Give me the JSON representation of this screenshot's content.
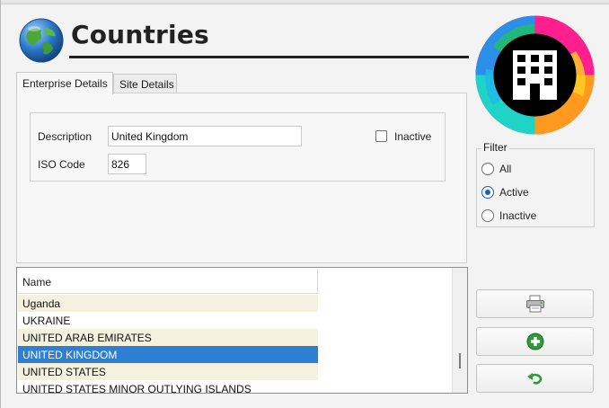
{
  "header": {
    "title": "Countries",
    "globe_icon": "globe-icon",
    "logo_icon": "building-icon"
  },
  "tabs": [
    {
      "label": "Enterprise Details",
      "active": true
    },
    {
      "label": "Site Details",
      "active": false
    }
  ],
  "details": {
    "description_label": "Description",
    "description_value": "United Kingdom",
    "iso_label": "ISO Code",
    "iso_value": "826",
    "inactive_label": "Inactive",
    "inactive_checked": false
  },
  "filter": {
    "title": "Filter",
    "options": [
      {
        "label": "All",
        "checked": false
      },
      {
        "label": "Active",
        "checked": true
      },
      {
        "label": "Inactive",
        "checked": false
      }
    ]
  },
  "grid": {
    "column": "Name",
    "rows": [
      "Uganda",
      "UKRAINE",
      "UNITED ARAB EMIRATES",
      "UNITED KINGDOM",
      "UNITED STATES",
      "UNITED STATES MINOR OUTLYING ISLANDS"
    ],
    "selected_index": 3
  },
  "actions": {
    "print_icon": "printer-icon",
    "add_icon": "add-icon",
    "undo_icon": "undo-icon"
  },
  "colors": {
    "accent": "#2d7fd4",
    "alt_row": "#f4f1df"
  }
}
